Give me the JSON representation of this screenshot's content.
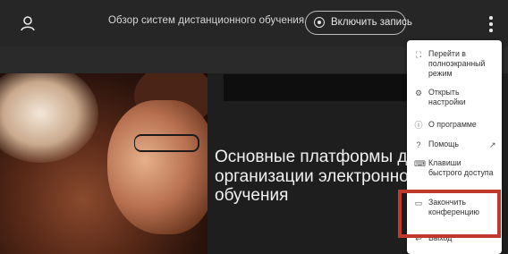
{
  "header": {
    "user_icon": "user-icon",
    "title": "Обзор систем дистанционного обучения",
    "record_button_label": "Включить запись",
    "menu_icon": "kebab-menu-icon"
  },
  "slide": {
    "lines": [
      "Основные платформы д",
      "организации электронно",
      "обучения"
    ]
  },
  "menu": {
    "items": [
      {
        "icon": "fullscreen-icon",
        "lines": [
          "Перейти в",
          "полноэкранный",
          "режим"
        ]
      },
      {
        "icon": "settings-icon",
        "lines": [
          "Открыть",
          "настройки"
        ]
      },
      {
        "icon": "info-icon",
        "lines": [
          "О программе"
        ]
      },
      {
        "icon": "help-icon",
        "lines": [
          "Помощь"
        ],
        "external_icon": "external-link-icon"
      },
      {
        "icon": "keyboard-icon",
        "lines": [
          "Клавиши",
          "быстрого доступа"
        ]
      },
      {
        "icon": "end-conference-icon",
        "lines": [
          "Закончить",
          "конференцию"
        ]
      },
      {
        "icon": "logout-icon",
        "lines": [
          "Выход"
        ]
      }
    ]
  },
  "colors": {
    "highlight": "#c0392b",
    "topbar": "#262626",
    "menu_bg": "#ffffff"
  }
}
